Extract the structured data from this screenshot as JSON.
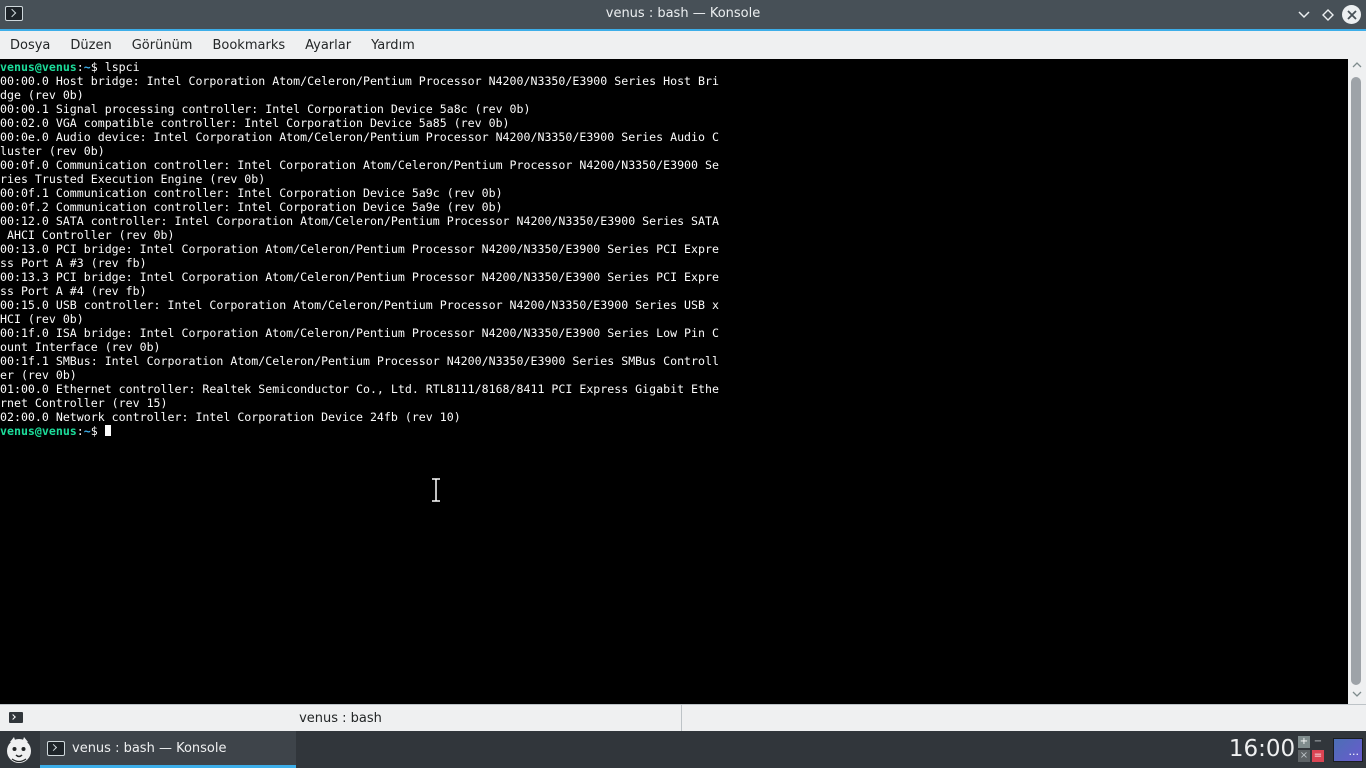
{
  "window": {
    "title": "venus : bash — Konsole"
  },
  "menu": {
    "items": [
      "Dosya",
      "Düzen",
      "Görünüm",
      "Bookmarks",
      "Ayarlar",
      "Yardım"
    ]
  },
  "terminal": {
    "prompt_user": "venus@venus",
    "prompt_path": "~",
    "prompt_symbol": "$",
    "command": " lspci",
    "output_lines": [
      "00:00.0 Host bridge: Intel Corporation Atom/Celeron/Pentium Processor N4200/N3350/E3900 Series Host Bri",
      "dge (rev 0b)",
      "00:00.1 Signal processing controller: Intel Corporation Device 5a8c (rev 0b)",
      "00:02.0 VGA compatible controller: Intel Corporation Device 5a85 (rev 0b)",
      "00:0e.0 Audio device: Intel Corporation Atom/Celeron/Pentium Processor N4200/N3350/E3900 Series Audio C",
      "luster (rev 0b)",
      "00:0f.0 Communication controller: Intel Corporation Atom/Celeron/Pentium Processor N4200/N3350/E3900 Se",
      "ries Trusted Execution Engine (rev 0b)",
      "00:0f.1 Communication controller: Intel Corporation Device 5a9c (rev 0b)",
      "00:0f.2 Communication controller: Intel Corporation Device 5a9e (rev 0b)",
      "00:12.0 SATA controller: Intel Corporation Atom/Celeron/Pentium Processor N4200/N3350/E3900 Series SATA",
      " AHCI Controller (rev 0b)",
      "00:13.0 PCI bridge: Intel Corporation Atom/Celeron/Pentium Processor N4200/N3350/E3900 Series PCI Expre",
      "ss Port A #3 (rev fb)",
      "00:13.3 PCI bridge: Intel Corporation Atom/Celeron/Pentium Processor N4200/N3350/E3900 Series PCI Expre",
      "ss Port A #4 (rev fb)",
      "00:15.0 USB controller: Intel Corporation Atom/Celeron/Pentium Processor N4200/N3350/E3900 Series USB x",
      "HCI (rev 0b)",
      "00:1f.0 ISA bridge: Intel Corporation Atom/Celeron/Pentium Processor N4200/N3350/E3900 Series Low Pin C",
      "ount Interface (rev 0b)",
      "00:1f.1 SMBus: Intel Corporation Atom/Celeron/Pentium Processor N4200/N3350/E3900 Series SMBus Controll",
      "er (rev 0b)",
      "01:00.0 Ethernet controller: Realtek Semiconductor Co., Ltd. RTL8111/8168/8411 PCI Express Gigabit Ethe",
      "rnet Controller (rev 15)",
      "02:00.0 Network controller: Intel Corporation Device 24fb (rev 10)"
    ]
  },
  "tab": {
    "label": "venus : bash"
  },
  "taskbar": {
    "task_label": "venus : bash — Konsole",
    "clock": "16:00",
    "show_desktop_label": "..."
  },
  "colors": {
    "accent": "#3daee9",
    "prompt_user": "#1cdc9a",
    "titlebar": "#475057"
  },
  "icons": {
    "app": "terminal-icon",
    "launcher": "plasma-launcher-icon",
    "cursor": "ibeam-cursor-icon"
  }
}
